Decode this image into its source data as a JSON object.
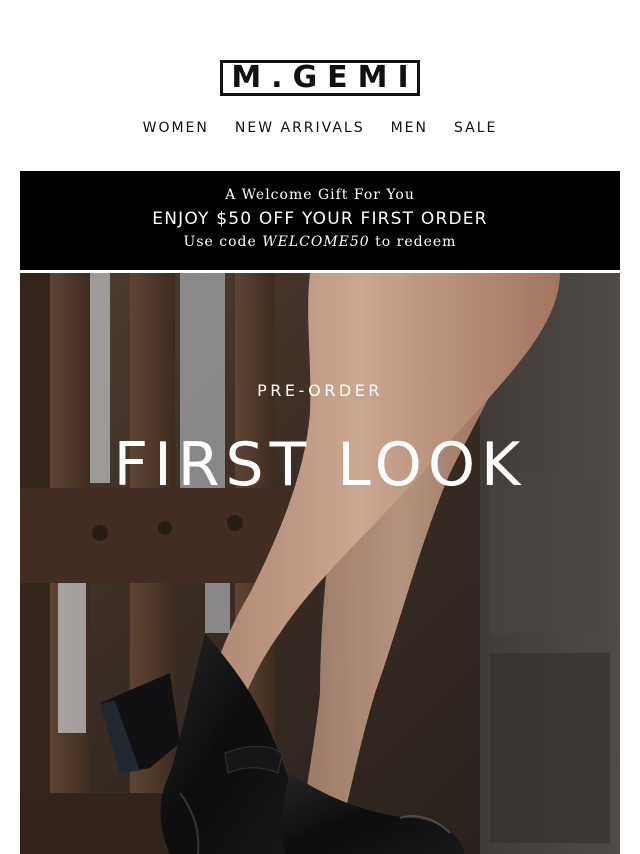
{
  "header": {
    "logo_text": "M.GEMI"
  },
  "nav": {
    "items": [
      {
        "label": "WOMEN"
      },
      {
        "label": "NEW ARRIVALS"
      },
      {
        "label": "MEN"
      },
      {
        "label": "SALE"
      }
    ]
  },
  "promo": {
    "gift": "A Welcome Gift For You",
    "offer": "ENJOY $50 OFF YOUR FIRST ORDER",
    "code_prefix": "Use code ",
    "code": "WELCOME50",
    "code_suffix": " to redeem"
  },
  "hero": {
    "eyebrow": "PRE-ORDER",
    "headline": "FIRST LOOK"
  },
  "colors": {
    "banner_bg": "#000000",
    "text_light": "#ffffff",
    "text_dark": "#111111"
  }
}
